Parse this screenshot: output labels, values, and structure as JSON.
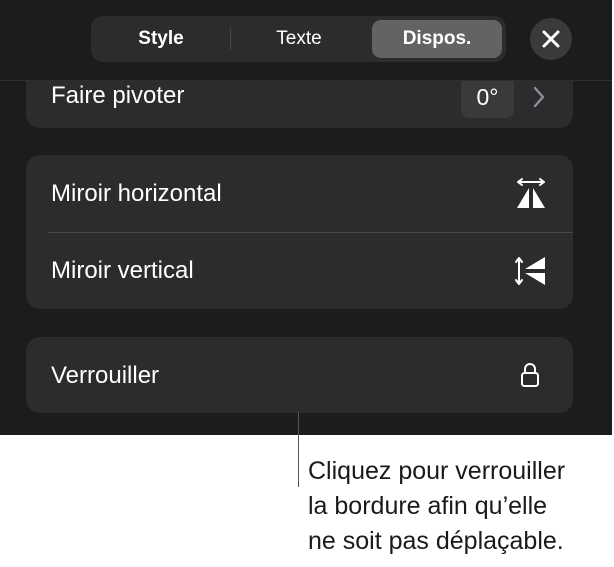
{
  "tabs": [
    {
      "label": "Style",
      "selected": false
    },
    {
      "label": "Texte",
      "selected": false
    },
    {
      "label": "Dispos.",
      "selected": true
    }
  ],
  "close_icon": "close-icon",
  "rotation": {
    "label": "Faire pivoter",
    "value": "0°",
    "chevron_icon": "chevron-right-icon"
  },
  "mirror": {
    "horizontal_label": "Miroir horizontal",
    "horizontal_icon": "flip-horizontal-icon",
    "vertical_label": "Miroir vertical",
    "vertical_icon": "flip-vertical-icon"
  },
  "lock": {
    "label": "Verrouiller",
    "icon": "lock-icon"
  },
  "callout": {
    "lines": [
      "Cliquez pour verrouiller",
      "la bordure afin qu’elle",
      "ne soit pas déplaçable."
    ]
  },
  "colors": {
    "panel_background": "#1c1c1e",
    "card_background": "#2c2c2e",
    "selected_tab": "#636366",
    "text": "#ffffff"
  }
}
